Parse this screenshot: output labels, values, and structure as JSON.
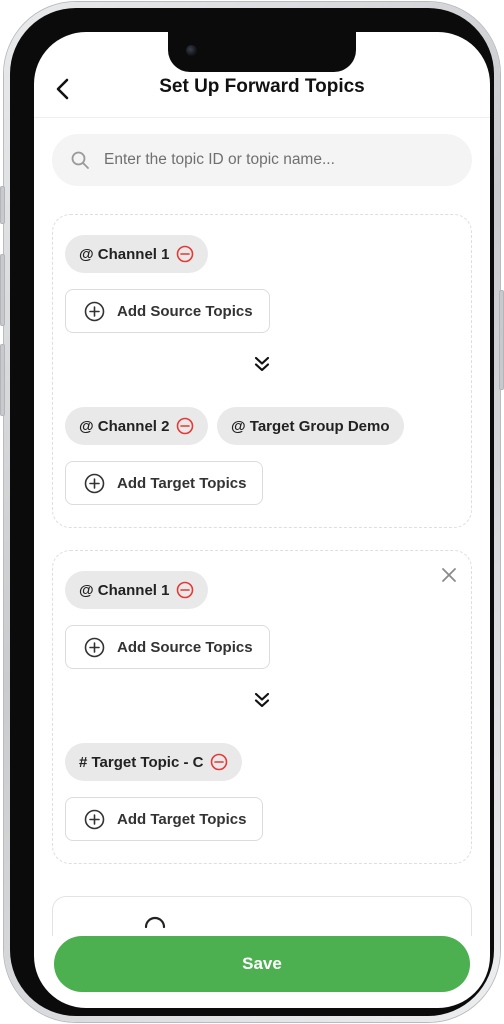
{
  "header": {
    "title": "Set Up Forward Topics"
  },
  "search": {
    "placeholder": "Enter the topic ID or topic name..."
  },
  "rules": [
    {
      "source_chips": [
        "@ Channel 1"
      ],
      "add_source_label": "Add Source Topics",
      "target_chips": [
        "@ Channel 2",
        "@ Target Group Demo"
      ],
      "add_target_label": "Add Target Topics"
    },
    {
      "source_chips": [
        "@ Channel 1"
      ],
      "add_source_label": "Add Source Topics",
      "target_chips": [
        "# Target Topic - C"
      ],
      "add_target_label": "Add Target Topics"
    }
  ],
  "footer": {
    "save_label": "Save"
  },
  "colors": {
    "accent_green": "#4caf50",
    "remove_red": "#e53935",
    "chip_bg": "#e9e9e9"
  }
}
